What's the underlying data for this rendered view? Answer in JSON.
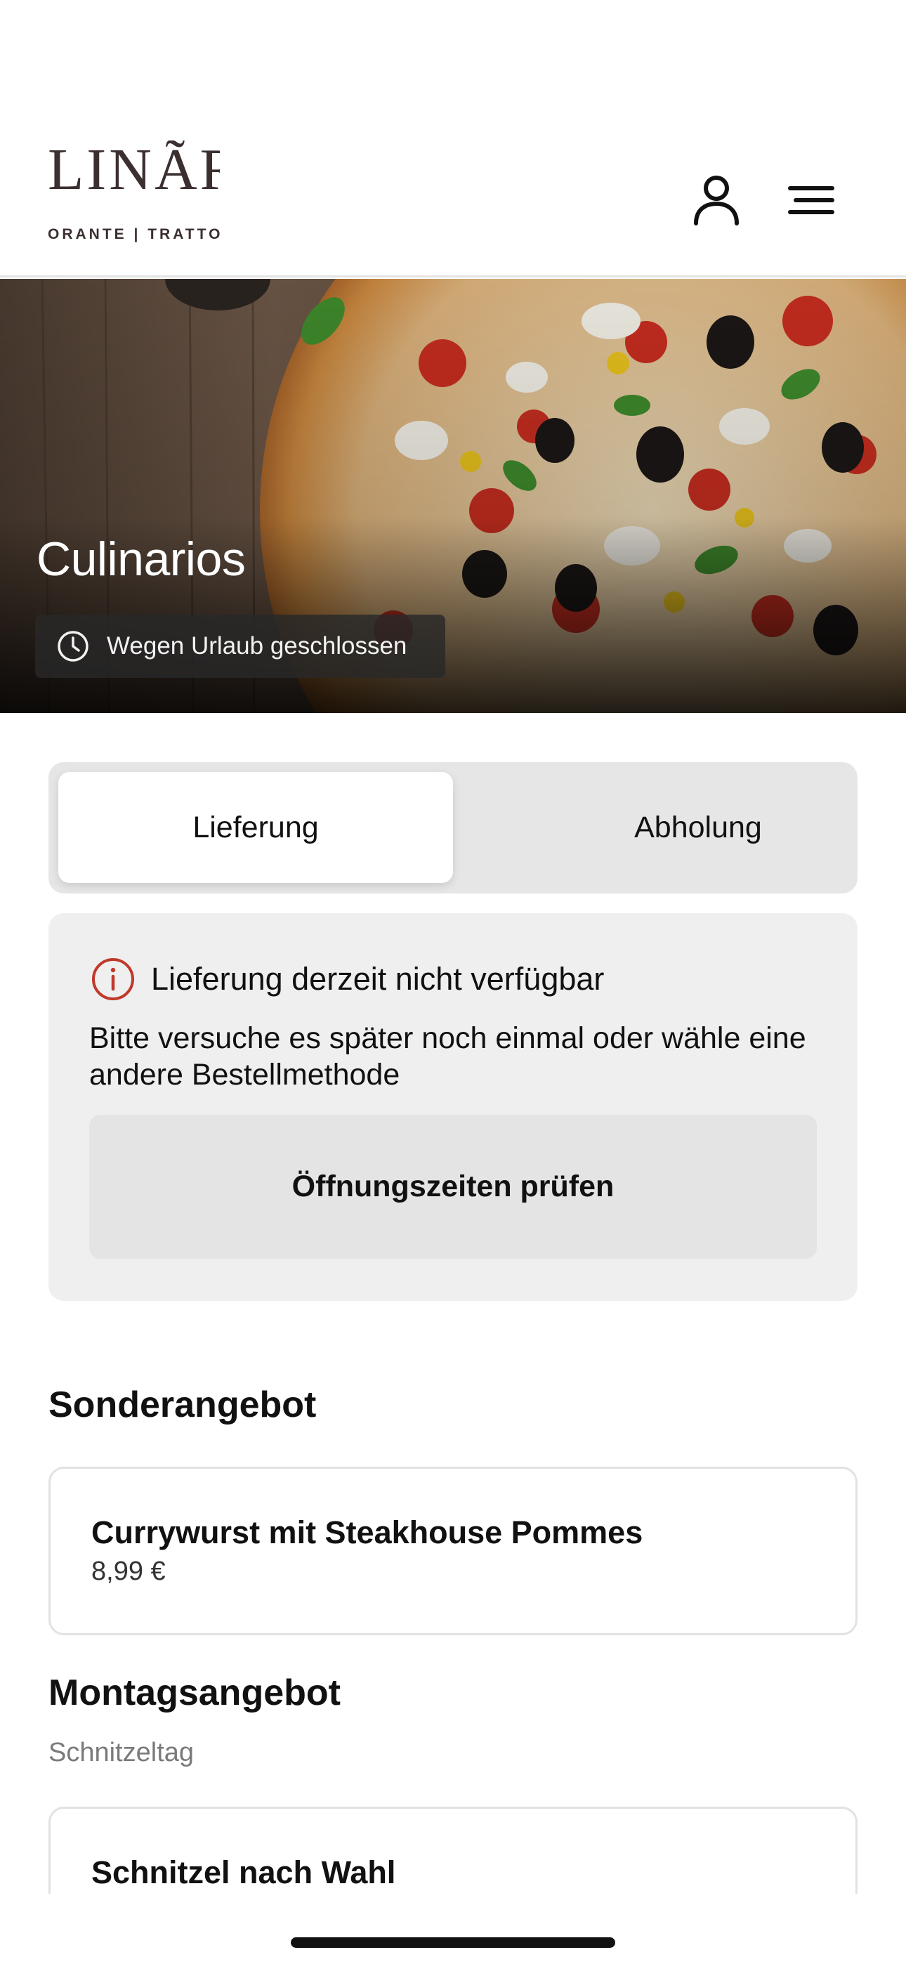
{
  "header": {
    "logo_text": "LINÃR",
    "logo_subtitle": "ORANTE | TRATTO",
    "icons": {
      "account": "user-icon",
      "menu": "hamburger-menu-icon"
    }
  },
  "hero": {
    "restaurant_name": "Culinarios",
    "status_text": "Wegen Urlaub geschlossen",
    "status_icon": "clock-icon"
  },
  "order_type": {
    "options": [
      "Lieferung",
      "Abholung"
    ],
    "selected": "Lieferung"
  },
  "notice": {
    "icon": "info-icon",
    "title": "Lieferung derzeit nicht verfügbar",
    "body": "Bitte versuche es später noch einmal oder wähle eine andere Bestellmethode",
    "button_label": "Öffnungszeiten prüfen"
  },
  "sections": [
    {
      "title": "Sonderangebot",
      "subtitle": "",
      "items": [
        {
          "name": "Currywurst mit Steakhouse Pommes",
          "price": "8,99 €"
        }
      ]
    },
    {
      "title": "Montagsangebot",
      "subtitle": "Schnitzeltag",
      "items": [
        {
          "name": "Schnitzel nach Wahl",
          "price": ""
        }
      ]
    }
  ],
  "colors": {
    "accent_error": "#c0392b",
    "card_background": "#efefef",
    "toggle_background": "#e6e6e6"
  }
}
